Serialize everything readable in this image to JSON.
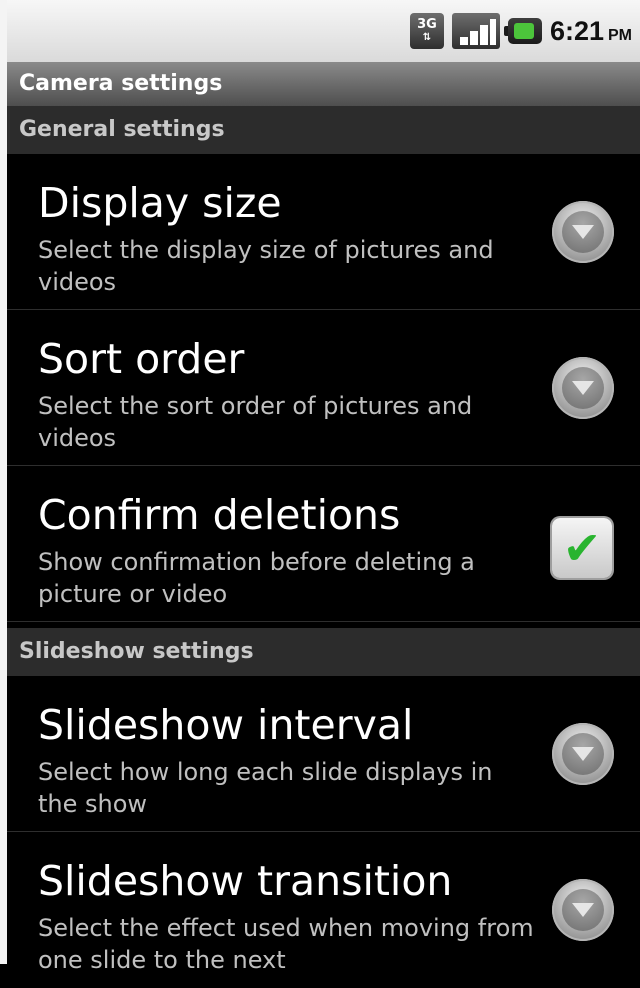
{
  "status_bar": {
    "network_icon": "3g-icon",
    "signal_icon": "signal-strength-icon",
    "battery_icon": "battery-charging-icon",
    "time": "6:21",
    "ampm": "PM"
  },
  "title_bar": {
    "title": "Camera settings"
  },
  "sections": [
    {
      "header": "General settings",
      "items": [
        {
          "title": "Display size",
          "summary": "Select the display size of pictures and videos",
          "control": "dropdown"
        },
        {
          "title": "Sort order",
          "summary": "Select the sort order of pictures and videos",
          "control": "dropdown"
        },
        {
          "title": "Confirm deletions",
          "summary": "Show confirmation before deleting a picture or video",
          "control": "checkbox",
          "checked": true
        }
      ]
    },
    {
      "header": "Slideshow settings",
      "items": [
        {
          "title": "Slideshow interval",
          "summary": "Select how long each slide displays in the show",
          "control": "dropdown"
        },
        {
          "title": "Slideshow transition",
          "summary": "Select the effect used when moving from one slide to the next",
          "control": "dropdown"
        }
      ]
    }
  ],
  "colors": {
    "background": "#000000",
    "section_header_bg": "#2c2c2c",
    "title_bar_bg": "#6a6a6a",
    "checkmark": "#29b42f"
  }
}
